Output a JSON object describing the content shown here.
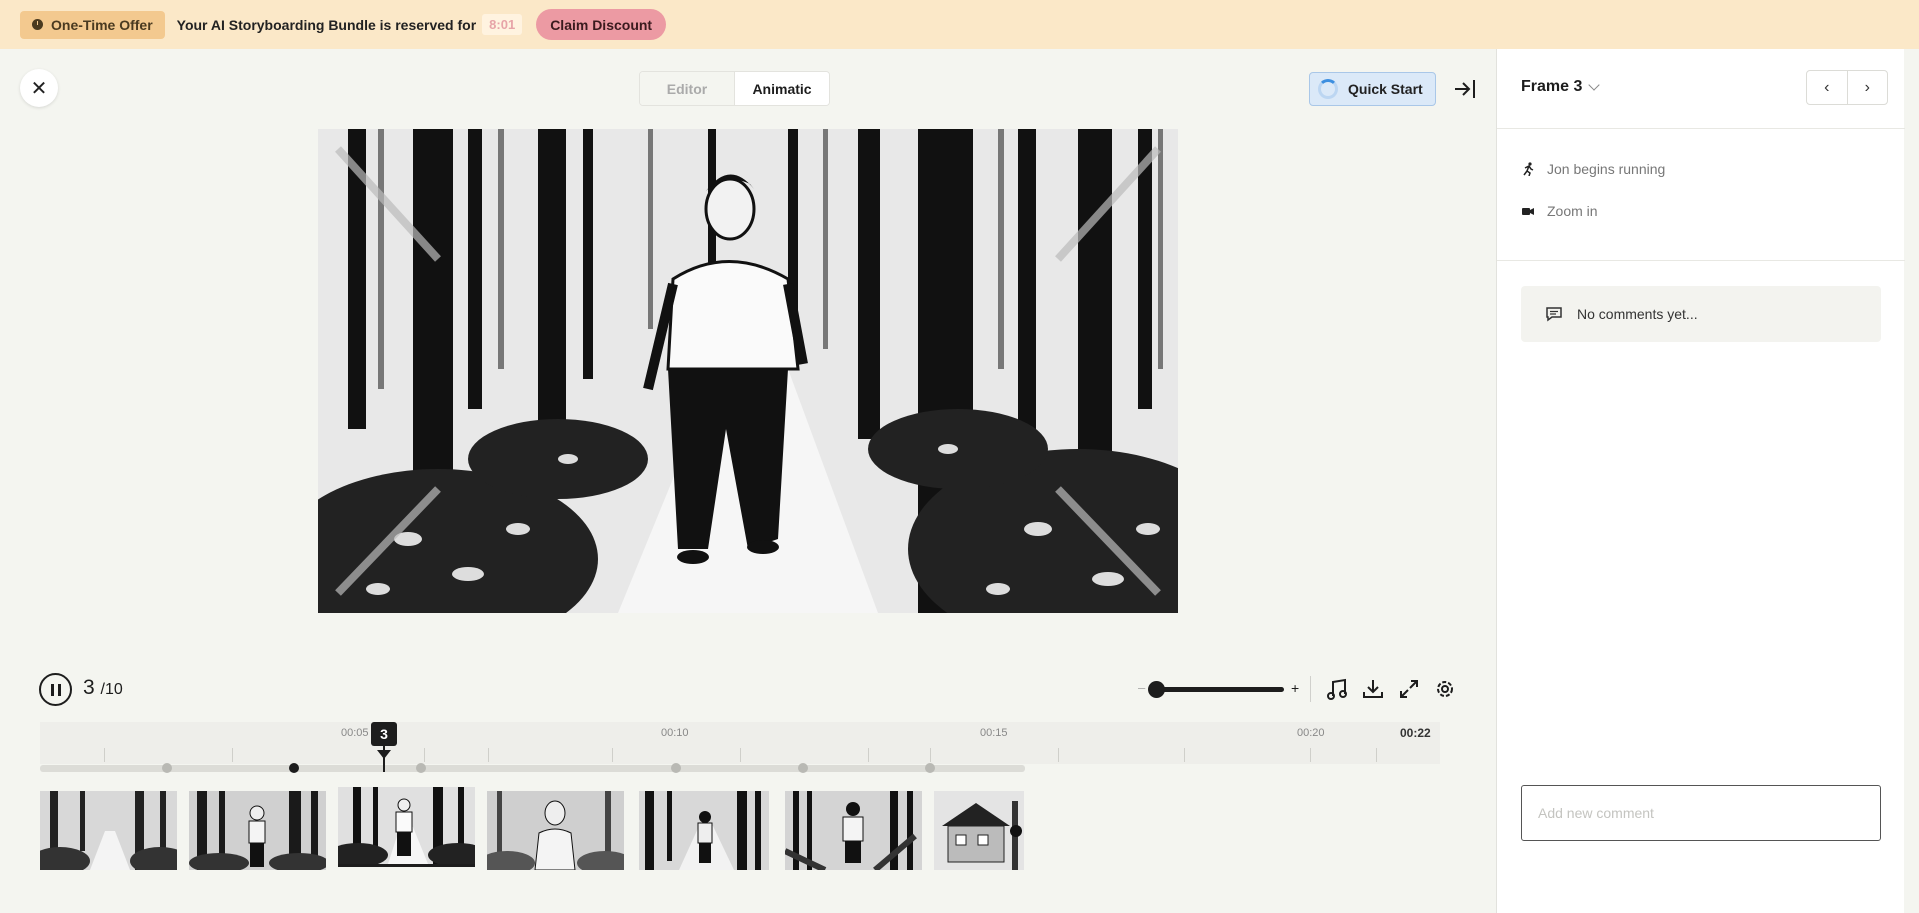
{
  "banner": {
    "offer_label": "One-Time Offer",
    "message": "Your AI Storyboarding Bundle is reserved for",
    "countdown": "8:01",
    "claim_label": "Claim Discount"
  },
  "topbar": {
    "close_label": "✕",
    "tabs": [
      {
        "label": "Editor",
        "active": false
      },
      {
        "label": "Animatic",
        "active": true
      }
    ],
    "quickstart_label": "Quick Start"
  },
  "playback": {
    "current_frame": "3",
    "total_frames": "/10",
    "zoom_minus": "–",
    "zoom_plus": "+",
    "zoom_level": 0.05
  },
  "timeline": {
    "ticks": [
      "00:05",
      "00:10",
      "00:15",
      "00:20"
    ],
    "end_time": "00:22",
    "playhead_label": "3",
    "frames": [
      {
        "n": 1,
        "scene": "forest-path"
      },
      {
        "n": 2,
        "scene": "man-standing-forest"
      },
      {
        "n": 3,
        "scene": "man-running-forest",
        "selected": true
      },
      {
        "n": 4,
        "scene": "man-closeup"
      },
      {
        "n": 5,
        "scene": "man-walking-away"
      },
      {
        "n": 6,
        "scene": "man-back-fallen-trees"
      },
      {
        "n": 7,
        "scene": "cabin"
      }
    ]
  },
  "right_panel": {
    "frame_title": "Frame 3",
    "prev_label": "‹",
    "next_label": "›",
    "actions": [
      {
        "icon": "running-icon",
        "label": "Jon begins running"
      },
      {
        "icon": "camera-icon",
        "label": "Zoom in"
      }
    ],
    "no_comments": "No comments yet...",
    "comment_placeholder": "Add new comment"
  },
  "colors": {
    "banner_bg": "#fbe8c8",
    "offer_pill": "#f3c98f",
    "claim_button": "#ec9aa3",
    "quickstart_bg": "#dbe9f8",
    "app_bg": "#f4f5f0"
  }
}
